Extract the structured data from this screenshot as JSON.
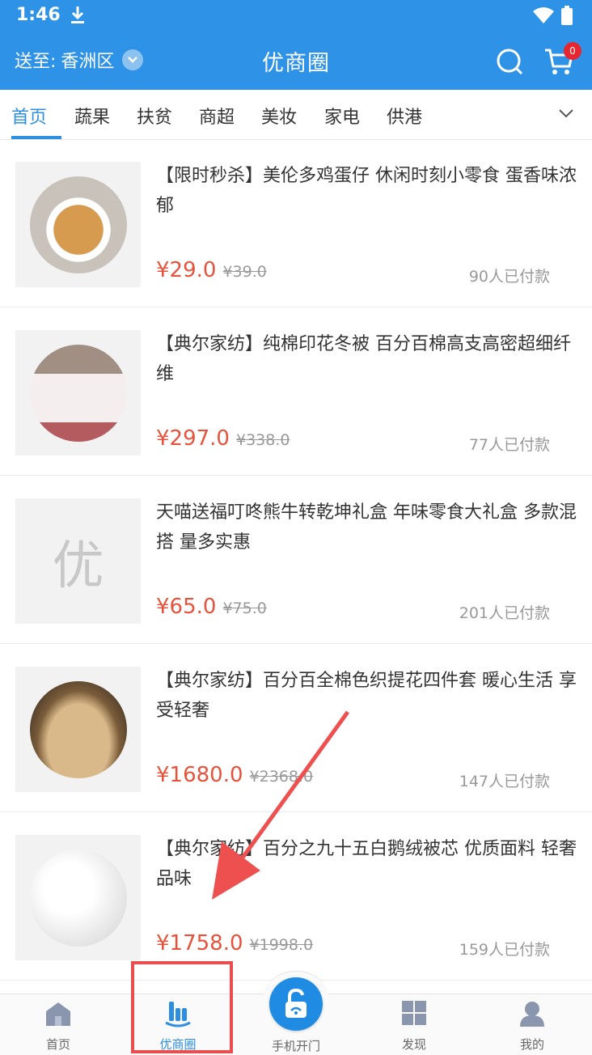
{
  "status_bar": {
    "time": "1:46"
  },
  "header": {
    "location_label": "送至:",
    "location_value": "香洲区",
    "title": "优商圈",
    "cart_count": "0"
  },
  "tabs": [
    {
      "label": "首页",
      "active": true
    },
    {
      "label": "蔬果"
    },
    {
      "label": "扶贫"
    },
    {
      "label": "商超"
    },
    {
      "label": "美妆"
    },
    {
      "label": "家电"
    },
    {
      "label": "供港"
    }
  ],
  "products": [
    {
      "title": "【限时秒杀】美伦多鸡蛋仔  休闲时刻小零食 蛋香味浓郁",
      "price": "¥29.0",
      "original_price": "¥39.0",
      "sold": "90人已付款"
    },
    {
      "title": "【典尔家纺】纯棉印花冬被 百分百棉高支高密超细纤维",
      "price": "¥297.0",
      "original_price": "¥338.0",
      "sold": "77人已付款"
    },
    {
      "title": "天喵送福叮咚熊牛转乾坤礼盒 年味零食大礼盒 多款混搭 量多实惠",
      "price": "¥65.0",
      "original_price": "¥75.0",
      "sold": "201人已付款",
      "placeholder_text": "优"
    },
    {
      "title": "【典尔家纺】百分百全棉色织提花四件套 暖心生活 享受轻奢",
      "price": "¥1680.0",
      "original_price": "¥2368.0",
      "sold": "147人已付款"
    },
    {
      "title": "【典尔家纺】百分之九十五白鹅绒被芯  优质面料 轻奢品味",
      "price": "¥1758.0",
      "original_price": "¥1998.0",
      "sold": "159人已付款"
    }
  ],
  "bottom_nav": [
    {
      "label": "首页",
      "icon": "home-icon"
    },
    {
      "label": "优商圈",
      "icon": "shop-circle-icon",
      "active": true
    },
    {
      "label": "手机开门",
      "icon": "unlock-icon"
    },
    {
      "label": "发现",
      "icon": "grid-icon"
    },
    {
      "label": "我的",
      "icon": "user-icon"
    }
  ],
  "colors": {
    "primary": "#2e92e6",
    "price": "#e5533c",
    "annotation": "#e94d4d",
    "badge": "#e8262f"
  }
}
